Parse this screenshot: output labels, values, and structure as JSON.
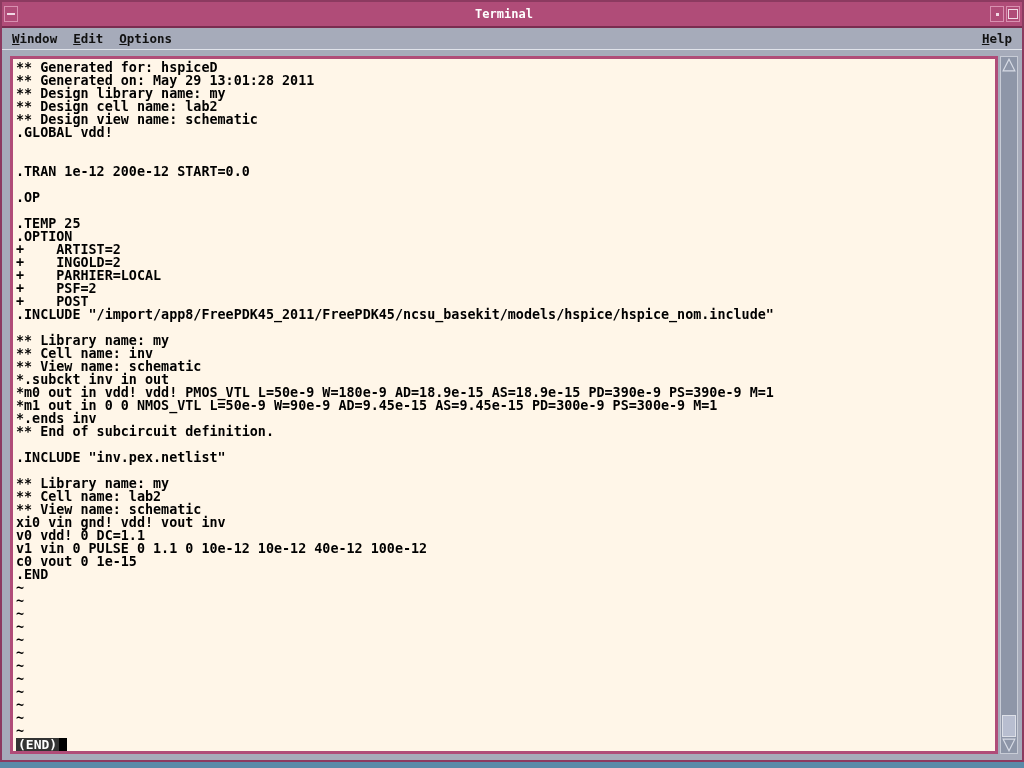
{
  "window": {
    "title": "Terminal"
  },
  "menu_bar": {
    "left": [
      {
        "label": "Window"
      },
      {
        "label": "Edit"
      },
      {
        "label": "Options"
      }
    ],
    "right": [
      {
        "label": "Help"
      }
    ]
  },
  "lines": [
    {
      "kind": "text",
      "text": "** Generated for: hspiceD"
    },
    {
      "kind": "text",
      "text": "** Generated on: May 29 13:01:28 2011"
    },
    {
      "kind": "text",
      "text": "** Design library name: my"
    },
    {
      "kind": "text",
      "text": "** Design cell name: lab2"
    },
    {
      "kind": "text",
      "text": "** Design view name: schematic"
    },
    {
      "kind": "text",
      "text": ".GLOBAL vdd!"
    },
    {
      "kind": "blank"
    },
    {
      "kind": "blank"
    },
    {
      "kind": "text",
      "text": ".TRAN 1e-12 200e-12 START=0.0"
    },
    {
      "kind": "blank"
    },
    {
      "kind": "text",
      "text": ".OP"
    },
    {
      "kind": "blank"
    },
    {
      "kind": "text",
      "text": ".TEMP 25"
    },
    {
      "kind": "text",
      "text": ".OPTION"
    },
    {
      "kind": "text",
      "text": "+    ARTIST=2"
    },
    {
      "kind": "text",
      "text": "+    INGOLD=2"
    },
    {
      "kind": "text",
      "text": "+    PARHIER=LOCAL"
    },
    {
      "kind": "text",
      "text": "+    PSF=2"
    },
    {
      "kind": "text",
      "text": "+    POST"
    },
    {
      "kind": "text",
      "text": ".INCLUDE \"/import/app8/FreePDK45_2011/FreePDK45/ncsu_basekit/models/hspice/hspice_nom.include\""
    },
    {
      "kind": "blank"
    },
    {
      "kind": "text",
      "text": "** Library name: my"
    },
    {
      "kind": "text",
      "text": "** Cell name: inv"
    },
    {
      "kind": "text",
      "text": "** View name: schematic"
    },
    {
      "kind": "text",
      "text": "*.subckt inv in out"
    },
    {
      "kind": "text",
      "text": "*m0 out in vdd! vdd! PMOS_VTL L=50e-9 W=180e-9 AD=18.9e-15 AS=18.9e-15 PD=390e-9 PS=390e-9 M=1"
    },
    {
      "kind": "text",
      "text": "*m1 out in 0 0 NMOS_VTL L=50e-9 W=90e-9 AD=9.45e-15 AS=9.45e-15 PD=300e-9 PS=300e-9 M=1"
    },
    {
      "kind": "text",
      "text": "*.ends inv"
    },
    {
      "kind": "text",
      "text": "** End of subcircuit definition."
    },
    {
      "kind": "blank"
    },
    {
      "kind": "text",
      "text": ".INCLUDE \"inv.pex.netlist\""
    },
    {
      "kind": "blank"
    },
    {
      "kind": "text",
      "text": "** Library name: my"
    },
    {
      "kind": "text",
      "text": "** Cell name: lab2"
    },
    {
      "kind": "text",
      "text": "** View name: schematic"
    },
    {
      "kind": "text",
      "text": "xi0 vin gnd! vdd! vout inv"
    },
    {
      "kind": "text",
      "text": "v0 vdd! 0 DC=1.1"
    },
    {
      "kind": "text",
      "text": "v1 vin 0 PULSE 0 1.1 0 10e-12 10e-12 40e-12 100e-12"
    },
    {
      "kind": "text",
      "text": "c0 vout 0 1e-15"
    },
    {
      "kind": "text",
      "text": ".END"
    },
    {
      "kind": "tilde",
      "text": "~"
    },
    {
      "kind": "tilde",
      "text": "~"
    },
    {
      "kind": "tilde",
      "text": "~"
    },
    {
      "kind": "tilde",
      "text": "~"
    },
    {
      "kind": "tilde",
      "text": "~"
    },
    {
      "kind": "tilde",
      "text": "~"
    },
    {
      "kind": "tilde",
      "text": "~"
    },
    {
      "kind": "tilde",
      "text": "~"
    },
    {
      "kind": "tilde",
      "text": "~"
    },
    {
      "kind": "tilde",
      "text": "~"
    },
    {
      "kind": "tilde",
      "text": "~"
    },
    {
      "kind": "tilde",
      "text": "~"
    }
  ],
  "status_line": {
    "text": "(END)"
  }
}
